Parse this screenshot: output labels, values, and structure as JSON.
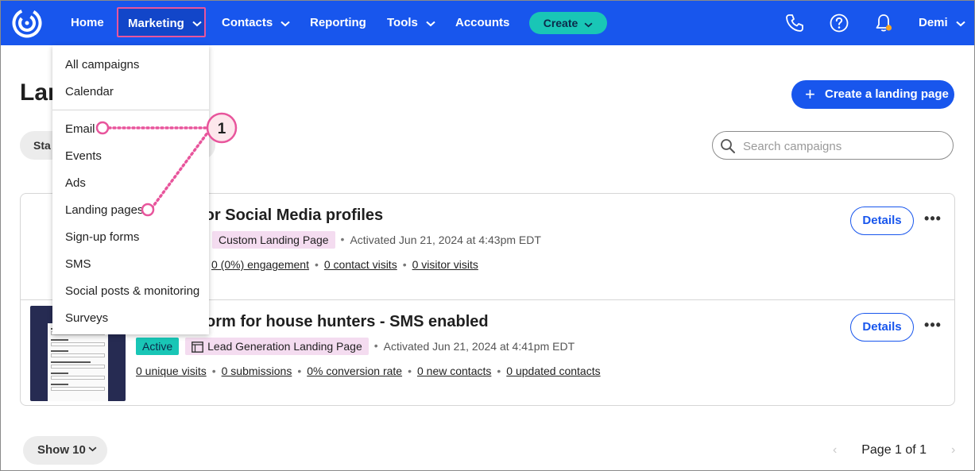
{
  "nav": {
    "items": [
      {
        "label": "Home"
      },
      {
        "label": "Marketing"
      },
      {
        "label": "Contacts"
      },
      {
        "label": "Reporting"
      },
      {
        "label": "Tools"
      },
      {
        "label": "Accounts"
      }
    ],
    "create_label": "Create",
    "user_label": "Demi",
    "icons": [
      "phone-icon",
      "help-icon",
      "bell-icon"
    ],
    "brand_color": "#1856ed",
    "accent_color": "#19c6b6",
    "notification_color": "#f5a623"
  },
  "menu": {
    "items": [
      {
        "label": "All campaigns"
      },
      {
        "label": "Calendar"
      },
      {
        "label": "Email"
      },
      {
        "label": "Events"
      },
      {
        "label": "Ads"
      },
      {
        "label": "Landing pages"
      },
      {
        "label": "Sign-up forms"
      },
      {
        "label": "SMS"
      },
      {
        "label": "Social posts & monitoring"
      },
      {
        "label": "Surveys"
      }
    ]
  },
  "callout": {
    "number": "1",
    "color": "#e8559c"
  },
  "page": {
    "title": "Lan",
    "status_filter": "Sta",
    "create_button": "Create a landing page",
    "search_placeholder": "Search campaigns"
  },
  "rows": [
    {
      "title": "o” page for Social Media profiles",
      "type": "Custom Landing Page",
      "activated": "Activated Jun 21, 2024 at 4:43pm EDT",
      "stats": [
        "0 (0%) engagement",
        "0 contact visits",
        "0 visitor visits"
      ],
      "details": "Details"
    },
    {
      "title": "orm for house hunters - SMS enabled",
      "status": "Active",
      "type": "Lead Generation Landing Page",
      "activated": "Activated Jun 21, 2024 at 4:41pm EDT",
      "stats": [
        "0 unique visits",
        "0 submissions",
        "0% conversion rate",
        "0 new contacts",
        "0 updated contacts"
      ],
      "details": "Details"
    }
  ],
  "footer": {
    "show_label": "Show 10",
    "page_label": "Page 1 of 1"
  }
}
